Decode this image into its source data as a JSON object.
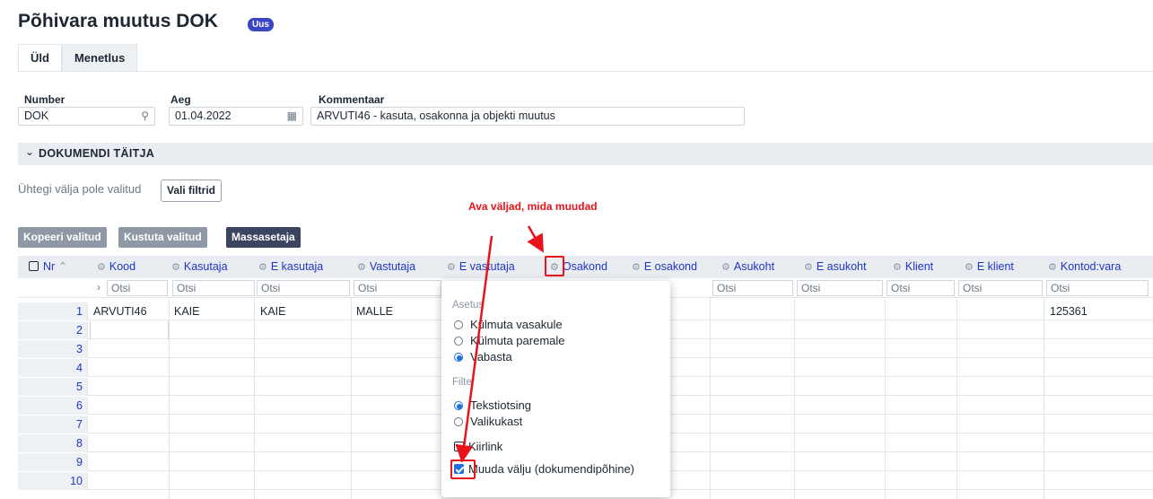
{
  "page": {
    "title": "Põhivara muutus DOK",
    "badge": "Uus",
    "tabs": [
      {
        "label": "Üld"
      },
      {
        "label": "Menetlus"
      }
    ]
  },
  "header_fields": {
    "number": {
      "label": "Number",
      "value": "DOK",
      "icon": "search-icon"
    },
    "aeg": {
      "label": "Aeg",
      "value": "01.04.2022",
      "icon": "calendar-icon"
    },
    "kommentaar": {
      "label": "Kommentaar",
      "value": "ARVUTI46 - kasuta, osakonna ja objekti muutus"
    }
  },
  "section": {
    "title": "DOKUMENDI TÄITJA"
  },
  "filters": {
    "none_selected_text": "Ühtegi välja pole valitud",
    "choose_button": "Vali filtrid"
  },
  "annotation": {
    "text": "Ava väljad, mida muudad",
    "color": "#e8131b"
  },
  "toolbar": {
    "copy_selected": "Kopeeri valitud",
    "delete_selected": "Kustuta valitud",
    "mass_setter": "Massasetaja"
  },
  "grid": {
    "header_nr": "Nr",
    "columns": [
      {
        "label": "Kood"
      },
      {
        "label": "Kasutaja"
      },
      {
        "label": "E kasutaja"
      },
      {
        "label": "Vastutaja"
      },
      {
        "label": "E vastutaja"
      },
      {
        "label": "Osakond"
      },
      {
        "label": "E osakond"
      },
      {
        "label": "Asukoht"
      },
      {
        "label": "E asukoht"
      },
      {
        "label": "Klient"
      },
      {
        "label": "E klient"
      },
      {
        "label": "Kontod:vara"
      }
    ],
    "search_placeholder": "Otsi",
    "rows": [
      {
        "nr": "1",
        "kood": "ARVUTI46",
        "kasutaja": "KAIE",
        "e_kasutaja": "KAIE",
        "vastutaja": "MALLE",
        "kontod_vara": "125361"
      },
      {
        "nr": "2"
      },
      {
        "nr": "3"
      },
      {
        "nr": "4"
      },
      {
        "nr": "5"
      },
      {
        "nr": "6"
      },
      {
        "nr": "7"
      },
      {
        "nr": "8"
      },
      {
        "nr": "9"
      },
      {
        "nr": "10"
      }
    ]
  },
  "column_popup": {
    "settings_title": "Asetus",
    "settings_options": [
      {
        "label": "Külmuta vasakule",
        "selected": false
      },
      {
        "label": "Külmuta paremale",
        "selected": false
      },
      {
        "label": "Vabasta",
        "selected": true
      }
    ],
    "filter_title": "Filter",
    "filter_options": [
      {
        "label": "Tekstiotsing",
        "selected": true
      },
      {
        "label": "Valikukast",
        "selected": false
      }
    ],
    "quicklink": {
      "label": "Kiirlink",
      "checked": false
    },
    "edit_field": {
      "label": "Muuda välju (dokumendipõhine)",
      "checked": true
    }
  }
}
